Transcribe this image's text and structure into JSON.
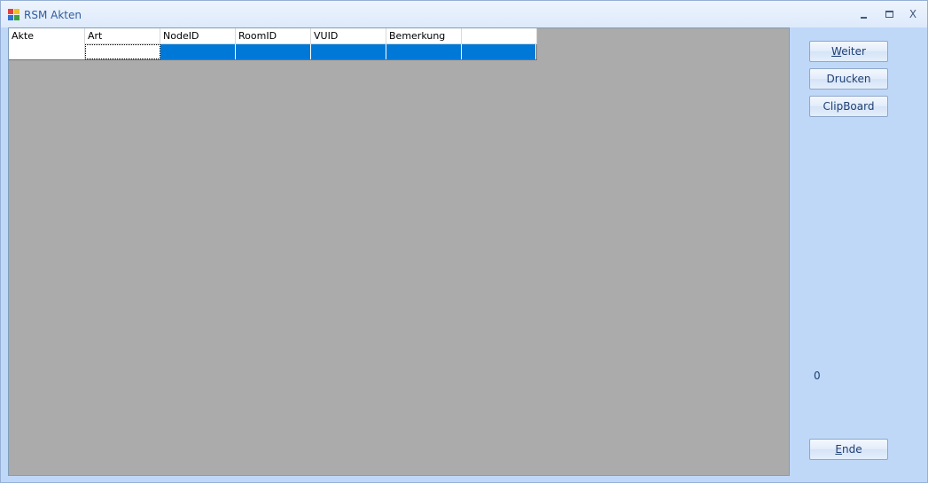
{
  "window": {
    "title": "RSM Akten",
    "minimize_label": "_",
    "close_label": "X"
  },
  "grid": {
    "columns": [
      "Akte",
      "Art",
      "NodeID",
      "RoomID",
      "VUID",
      "Bemerkung",
      ""
    ],
    "rows": [
      {
        "Art": "",
        "NodeID": "",
        "RoomID": "",
        "VUID": "",
        "Bemerkung": "",
        "extra": ""
      }
    ],
    "selection_color": "#0078d7"
  },
  "buttons": {
    "weiter": {
      "mnemonic": "W",
      "rest": "eiter"
    },
    "drucken": "Drucken",
    "clipboard": "ClipBoard",
    "ende": {
      "mnemonic": "E",
      "rest": "nde"
    }
  },
  "status": {
    "count": "0"
  }
}
